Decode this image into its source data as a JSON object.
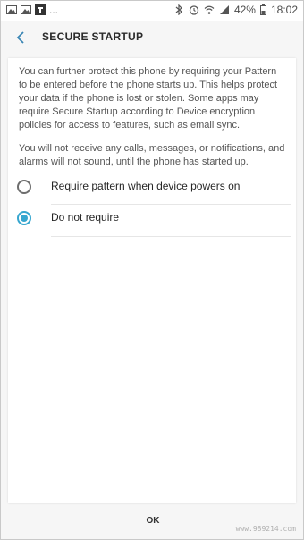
{
  "status_bar": {
    "left_icons": [
      "gallery-icon",
      "gallery-icon",
      "app-icon"
    ],
    "overflow": "...",
    "right_icons": [
      "bluetooth-icon",
      "alarm-icon",
      "wifi-icon",
      "signal-icon"
    ],
    "battery": "42%",
    "time": "18:02"
  },
  "header": {
    "back_icon": "back-chevron-icon",
    "title": "SECURE STARTUP"
  },
  "content": {
    "description_1": "You can further protect this phone by requiring your Pattern to be entered before the phone starts up. This helps protect your data if the phone is lost or stolen. Some apps may require Secure Startup according to Device encryption policies for access to features, such as email sync.",
    "description_2": "You will not receive any calls, messages, or notifications, and alarms will not sound, until the phone has started up.",
    "options": [
      {
        "label": "Require pattern when device powers on",
        "selected": false
      },
      {
        "label": "Do not require",
        "selected": true
      }
    ]
  },
  "footer": {
    "ok_label": "OK"
  },
  "watermark": "www.989214.com",
  "colors": {
    "accent": "#36a6cf",
    "background": "#f6f6f6"
  }
}
